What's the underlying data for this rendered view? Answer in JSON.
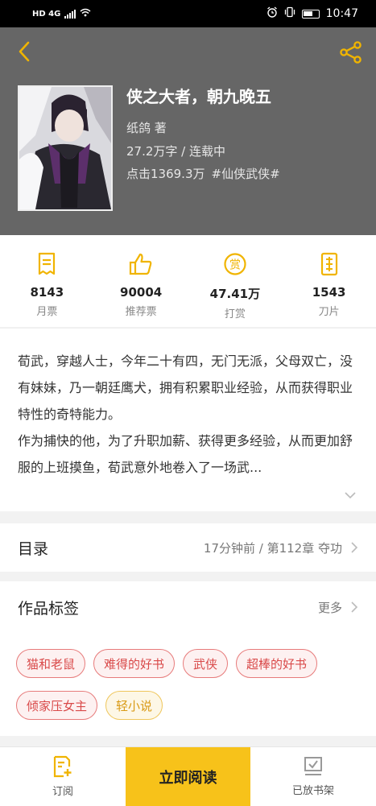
{
  "status_bar": {
    "network": "HD 4G",
    "time": "10:47"
  },
  "book": {
    "title": "侠之大者，朝九晚五",
    "author": "纸鸽  著",
    "word_count_status": "27.2万字 / 连载中",
    "clicks": "点击1369.3万",
    "genre_tag": "#仙侠武侠#"
  },
  "stats": [
    {
      "value": "8143",
      "label": "月票",
      "icon": "monthly-ticket-icon"
    },
    {
      "value": "90004",
      "label": "推荐票",
      "icon": "thumbs-up-icon"
    },
    {
      "value": "47.41万",
      "label": "打赏",
      "icon": "reward-icon"
    },
    {
      "value": "1543",
      "label": "刀片",
      "icon": "blade-icon"
    }
  ],
  "synopsis": {
    "paragraph1": "荀武，穿越人士，今年二十有四，无门无派，父母双亡，没有妹妹，乃一朝廷鹰犬，拥有积累职业经验，从而获得职业特性的奇特能力。",
    "paragraph2": "作为捕快的他，为了升职加薪、获得更多经验，从而更加舒服的上班摸鱼，荀武意外地卷入了一场武..."
  },
  "toc": {
    "title": "目录",
    "latest": "17分钟前 / 第112章  夺功"
  },
  "tags": {
    "title": "作品标签",
    "more": "更多",
    "items": [
      "猫和老鼠",
      "难得的好书",
      "武侠",
      "超棒的好书",
      "倾家压女主",
      "轻小说"
    ]
  },
  "bottom_bar": {
    "subscribe": "订阅",
    "read_now": "立即阅读",
    "on_shelf": "已放书架"
  },
  "colors": {
    "accent": "#f7c21a",
    "icon_yellow": "#f0b400",
    "header_bg": "#666666",
    "tag_red": "#d94a4a",
    "tag_yellow": "#d99a15"
  }
}
